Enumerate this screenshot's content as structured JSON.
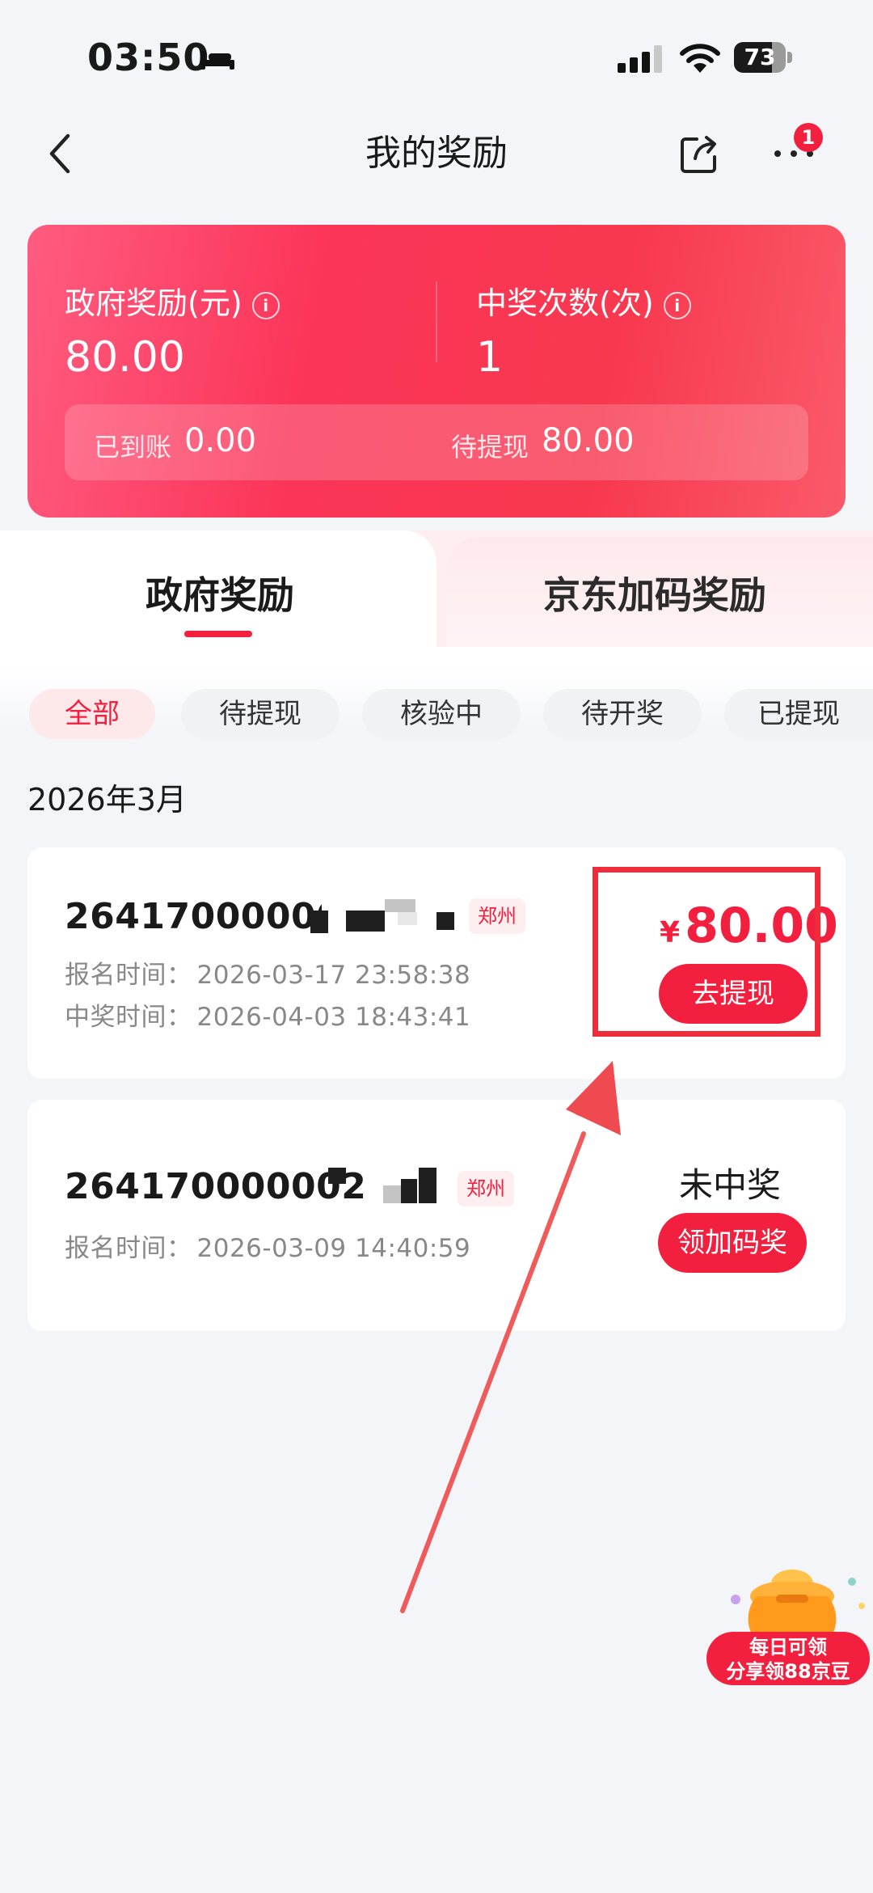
{
  "status_bar": {
    "time": "03:50",
    "battery": "73",
    "battery_level": 0.73
  },
  "header": {
    "title": "我的奖励",
    "more_badge": "1"
  },
  "summary": {
    "gov_reward_label": "政府奖励(元)",
    "gov_reward_value": "80.00",
    "win_count_label": "中奖次数(次)",
    "win_count_value": "1",
    "received_label": "已到账",
    "received_value": "0.00",
    "pending_label": "待提现",
    "pending_value": "80.00"
  },
  "tabs": [
    {
      "label": "政府奖励",
      "active": true
    },
    {
      "label": "京东加码奖励",
      "active": false
    }
  ],
  "filters": [
    {
      "label": "全部",
      "active": true
    },
    {
      "label": "待提现"
    },
    {
      "label": "核验中"
    },
    {
      "label": "待开奖"
    },
    {
      "label": "已提现"
    }
  ],
  "month": "2026年3月",
  "records": [
    {
      "id_visible": "264170000002",
      "city": "郑州",
      "signup_label": "报名时间：",
      "signup_time": "2026-03-17 23:58:38",
      "win_label": "中奖时间：",
      "win_time": "2026-04-03 18:43:41",
      "currency": "¥",
      "amount": "80.00",
      "action": "去提现"
    },
    {
      "id_visible": "264170000002",
      "city": "郑州",
      "signup_label": "报名时间：",
      "signup_time": "2026-03-09 14:40:59",
      "status": "未中奖",
      "action": "领加码奖"
    }
  ],
  "promo": {
    "line1": "每日可领",
    "line2": "分享领88京豆"
  },
  "colors": {
    "accent": "#f2203e",
    "card_gradient_start": "#ff5b80",
    "card_gradient_end": "#fa5a6a",
    "annotation": "#ef2d3a"
  }
}
